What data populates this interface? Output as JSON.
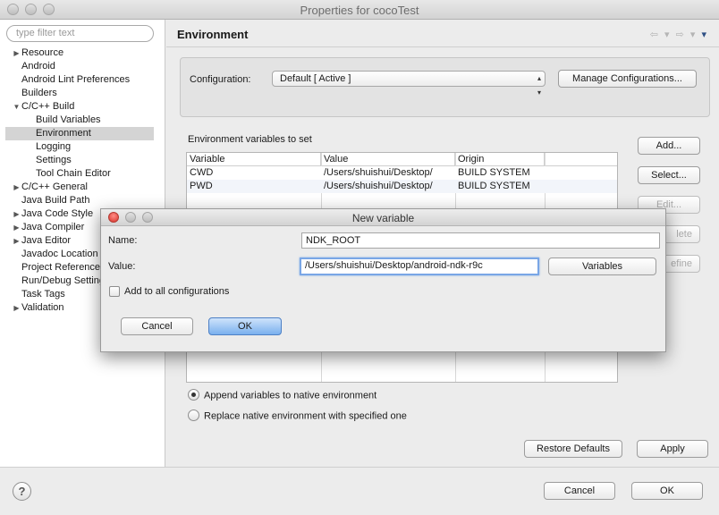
{
  "window": {
    "title": "Properties for cocoTest"
  },
  "filter": {
    "placeholder": "type filter text"
  },
  "tree": [
    {
      "label": "Resource",
      "toggle": "▶",
      "indent": 0
    },
    {
      "label": "Android",
      "toggle": "",
      "indent": 0
    },
    {
      "label": "Android Lint Preferences",
      "toggle": "",
      "indent": 0
    },
    {
      "label": "Builders",
      "toggle": "",
      "indent": 0
    },
    {
      "label": "C/C++ Build",
      "toggle": "▼",
      "indent": 0
    },
    {
      "label": "Build Variables",
      "toggle": "",
      "indent": 1
    },
    {
      "label": "Environment",
      "toggle": "",
      "indent": 1,
      "selected": true
    },
    {
      "label": "Logging",
      "toggle": "",
      "indent": 1
    },
    {
      "label": "Settings",
      "toggle": "",
      "indent": 1
    },
    {
      "label": "Tool Chain Editor",
      "toggle": "",
      "indent": 1
    },
    {
      "label": "C/C++ General",
      "toggle": "▶",
      "indent": 0
    },
    {
      "label": "Java Build Path",
      "toggle": "",
      "indent": 0
    },
    {
      "label": "Java Code Style",
      "toggle": "▶",
      "indent": 0
    },
    {
      "label": "Java Compiler",
      "toggle": "▶",
      "indent": 0
    },
    {
      "label": "Java Editor",
      "toggle": "▶",
      "indent": 0
    },
    {
      "label": "Javadoc Location",
      "toggle": "",
      "indent": 0
    },
    {
      "label": "Project References",
      "toggle": "",
      "indent": 0
    },
    {
      "label": "Run/Debug Settings",
      "toggle": "",
      "indent": 0
    },
    {
      "label": "Task Tags",
      "toggle": "",
      "indent": 0
    },
    {
      "label": "Validation",
      "toggle": "▶",
      "indent": 0
    }
  ],
  "panel": {
    "title": "Environment",
    "nav_back": "⇦ ▾",
    "nav_forward": "⇨ ▾",
    "nav_menu": "▾",
    "config_label": "Configuration:",
    "config_value": "Default  [ Active ]",
    "manage_button": "Manage Configurations...",
    "env_label": "Environment variables to set",
    "columns": [
      "Variable",
      "Value",
      "Origin"
    ],
    "rows": [
      {
        "variable": "CWD",
        "value": "/Users/shuishui/Desktop/",
        "origin": "BUILD SYSTEM"
      },
      {
        "variable": "PWD",
        "value": "/Users/shuishui/Desktop/",
        "origin": "BUILD SYSTEM"
      }
    ],
    "add_button": "Add...",
    "select_button": "Select...",
    "edit_button": "Edit...",
    "delete_button_partial": "lete",
    "undefine_button_partial": "efine",
    "append_radio": "Append variables to native environment",
    "replace_radio": "Replace native environment with specified one",
    "restore_button": "Restore Defaults",
    "apply_button": "Apply"
  },
  "footer": {
    "help_label": "?",
    "cancel_button": "Cancel",
    "ok_button": "OK"
  },
  "modal": {
    "title": "New variable",
    "name_label": "Name:",
    "name_value": "NDK_ROOT",
    "value_label": "Value:",
    "value_value": "/Users/shuishui/Desktop/android-ndk-r9c",
    "variables_button": "Variables",
    "checkbox_label": "Add to all configurations",
    "cancel_button": "Cancel",
    "ok_button": "OK"
  }
}
